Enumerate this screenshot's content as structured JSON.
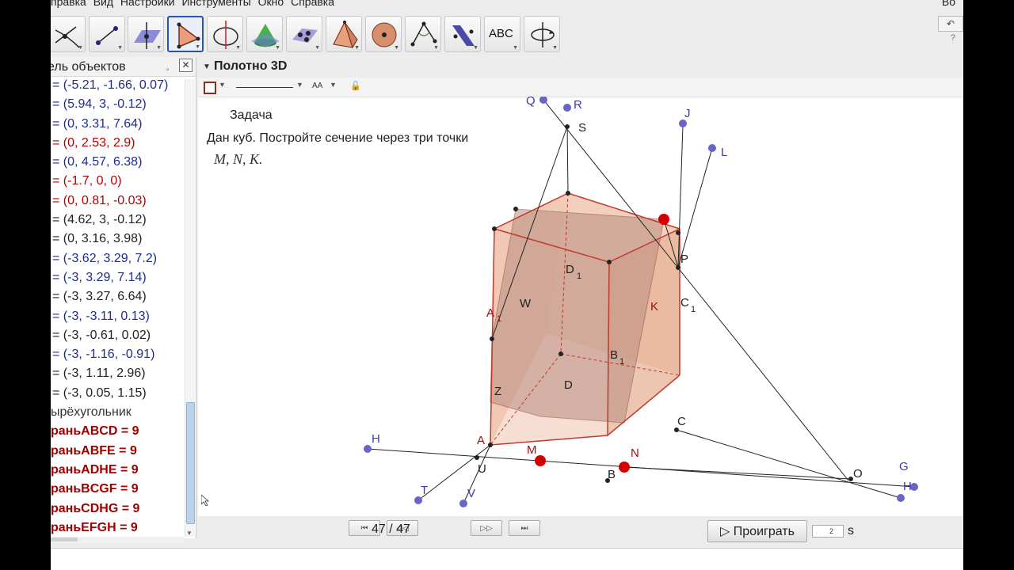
{
  "menubar": {
    "items": [
      "правка",
      "Вид",
      "Настройки",
      "Инструменты",
      "Окно",
      "Справка"
    ],
    "right_text": "Во"
  },
  "toolbar": {
    "tools": [
      {
        "name": "move-graphic-icon",
        "active": false
      },
      {
        "name": "segment-icon",
        "active": false
      },
      {
        "name": "plane-icon",
        "active": false
      },
      {
        "name": "polygon-icon",
        "active": true
      },
      {
        "name": "circle-axis-icon",
        "active": false
      },
      {
        "name": "cone-icon",
        "active": false
      },
      {
        "name": "plane-points-icon",
        "active": false
      },
      {
        "name": "pyramid-icon",
        "active": false
      },
      {
        "name": "sphere-icon",
        "active": false
      },
      {
        "name": "angle-icon",
        "active": false
      },
      {
        "name": "reflect-icon",
        "active": false
      },
      {
        "name": "text-icon",
        "active": false,
        "label": "ABC"
      },
      {
        "name": "rotate-view-icon",
        "active": false
      }
    ],
    "undo_label": "↶",
    "help_label": "?"
  },
  "algebra": {
    "title": "ель объектов",
    "restore_icon": "▫",
    "close_icon": "✕",
    "rows": [
      {
        "text": "= (-5.21, -1.66, 0.07)",
        "color": "blue"
      },
      {
        "text": "= (5.94, 3, -0.12)",
        "color": "blue"
      },
      {
        "text": "= (0, 3.31, 7.64)",
        "color": "blue"
      },
      {
        "text": "= (0, 2.53, 2.9)",
        "color": "red"
      },
      {
        "text": "= (0, 4.57, 6.38)",
        "color": "blue"
      },
      {
        "text": "= (-1.7, 0, 0)",
        "color": "red"
      },
      {
        "text": "= (0, 0.81, -0.03)",
        "color": "red"
      },
      {
        "text": "= (4.62, 3, -0.12)",
        "color": "dark"
      },
      {
        "text": "= (0, 3.16, 3.98)",
        "color": "dark"
      },
      {
        "text": "= (-3.62, 3.29, 7.2)",
        "color": "blue"
      },
      {
        "text": "= (-3, 3.29, 7.14)",
        "color": "blue"
      },
      {
        "text": "= (-3, 3.27, 6.64)",
        "color": "dark"
      },
      {
        "text": "= (-3, -3.11, 0.13)",
        "color": "blue"
      },
      {
        "text": "= (-3, -0.61, 0.02)",
        "color": "dark"
      },
      {
        "text": "= (-3, -1.16, -0.91)",
        "color": "blue"
      },
      {
        "text": "= (-3, 1.11, 2.96)",
        "color": "dark"
      },
      {
        "text": "= (-3, 0.05, 1.15)",
        "color": "dark"
      },
      {
        "text": "ырёхугольник",
        "color": "plain"
      },
      {
        "text": "раньABCD = 9",
        "color": "face"
      },
      {
        "text": "раньABFE = 9",
        "color": "face"
      },
      {
        "text": "раньADHE = 9",
        "color": "face"
      },
      {
        "text": "раньBCGF = 9",
        "color": "face"
      },
      {
        "text": "раньCDHG = 9",
        "color": "face"
      },
      {
        "text": "раньEFGH = 9",
        "color": "face"
      }
    ]
  },
  "view3d": {
    "title": "Полотно 3D",
    "task_title": "Задача",
    "task_text": "Дан куб. Постройте сечение через три точки",
    "task_points": "M, N, K.",
    "point_labels": [
      "Q",
      "R",
      "S",
      "J",
      "L",
      "P",
      "D",
      "1",
      "A",
      "1",
      "W",
      "K",
      "C",
      "1",
      "B",
      "1",
      "D",
      "Z",
      "C",
      "H",
      "A",
      "M",
      "N",
      "U",
      "B",
      "T",
      "V",
      "O",
      "G",
      "H"
    ]
  },
  "navigation": {
    "counter": "47 / 47",
    "first_icon": "⏮",
    "prev_icon": "◁◁",
    "next_icon": "▷▷",
    "last_icon": "⏭",
    "play_label": "▷ Проиграть",
    "speed_value": "2",
    "speed_unit": "s"
  },
  "colors": {
    "cube_fill": "#e9b196",
    "section_fill": "#c99a88",
    "edge": "#c0392b",
    "point_blue": "#6a63c8",
    "point_red": "#d40000",
    "label_blue": "#3a3ab0"
  }
}
